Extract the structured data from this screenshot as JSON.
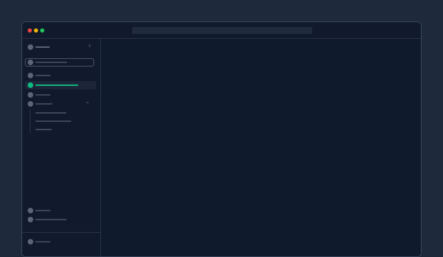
{
  "window": {
    "traffic_lights": {
      "close_color": "#ef4444",
      "minimize_color": "#eab308",
      "maximize_color": "#22c55e"
    }
  },
  "colors": {
    "background": "#1e293b",
    "window": "#111a2c",
    "accent": "#10b981",
    "placeholder_line": "#3d485b",
    "icon_placeholder": "#5b6577"
  },
  "sidebar": {
    "workspace_switcher": {
      "icon": "avatar-icon",
      "chevron": "chevron-updown-icon"
    },
    "search": {
      "icon": "search-icon"
    },
    "nav_items": [
      {
        "id": "item-1",
        "icon": "nav-icon",
        "active": false
      },
      {
        "id": "item-2",
        "icon": "nav-icon",
        "active": true
      },
      {
        "id": "item-3",
        "icon": "nav-icon",
        "active": false
      },
      {
        "id": "item-4",
        "icon": "nav-icon",
        "active": false,
        "expanded": true,
        "chevron": "chevron-up-icon",
        "children": [
          "child-1",
          "child-2",
          "child-3"
        ]
      }
    ],
    "bottom_items": [
      {
        "id": "bottom-1",
        "icon": "nav-icon"
      },
      {
        "id": "bottom-2",
        "icon": "nav-icon"
      }
    ],
    "footer": {
      "icon": "user-avatar-icon"
    }
  }
}
